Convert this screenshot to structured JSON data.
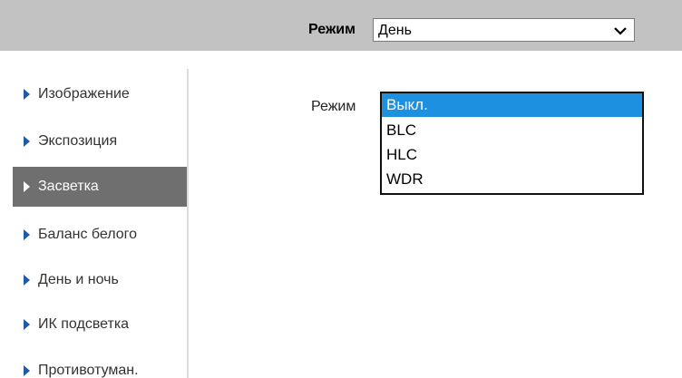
{
  "header": {
    "mode_label": "Режим",
    "mode_value": "День"
  },
  "sidebar": {
    "items": [
      {
        "label": "Изображение",
        "active": false
      },
      {
        "label": "Экспозиция",
        "active": false
      },
      {
        "label": "Засветка",
        "active": true
      },
      {
        "label": "Баланс белого",
        "active": false
      },
      {
        "label": "День и ночь",
        "active": false
      },
      {
        "label": "ИК подсветка",
        "active": false
      },
      {
        "label": "Противотуман.",
        "active": false
      }
    ]
  },
  "main": {
    "mode_label": "Режим",
    "options": [
      {
        "label": "Выкл.",
        "selected": true
      },
      {
        "label": "BLC",
        "selected": false
      },
      {
        "label": "HLC",
        "selected": false
      },
      {
        "label": "WDR",
        "selected": false
      }
    ]
  },
  "colors": {
    "header_bg": "#c2c2c2",
    "active_item_bg": "#6f6f6f",
    "selected_option_bg": "#1e90e0",
    "arrow": "#1e5aa8"
  },
  "icons": {
    "dropdown": "chevron-down-icon",
    "nav_bullet": "triangle-right-icon"
  }
}
